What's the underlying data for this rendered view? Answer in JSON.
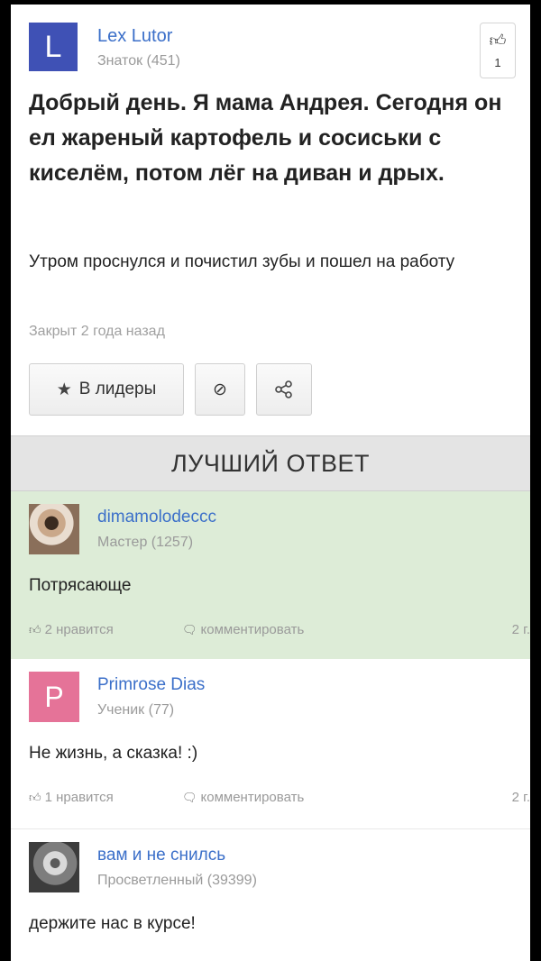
{
  "question": {
    "avatar_letter": "L",
    "user_name": "Lex Lutor",
    "user_rank": "Знаток (451)",
    "like_icon": "thumbs-up-icon",
    "like_count": "1",
    "title": "Добрый день. Я мама Андрея. Сегодня он ел жареный картофель и сосиськи с киселём, потом лёг на диван и дрых.",
    "body": "Утром проснулся и почистил зубы и пошел на работу",
    "closed": "Закрыт 2 года назад",
    "buttons": {
      "leaders_icon": "★",
      "leaders": "В лидеры",
      "block_icon": "⊘",
      "share_icon": "share-icon"
    },
    "colors": {
      "avatar": "#3f51b5",
      "link": "#3b6fc9"
    }
  },
  "best_answer_label": "ЛУЧШИЙ ОТВЕТ",
  "answers": [
    {
      "user_name": "dimamolodeccc",
      "user_rank": "Мастер (1257)",
      "avatar": "cat-photo",
      "text": "Потрясающе",
      "likes": "2 нравится",
      "comment": "комментировать",
      "time": "2 г.",
      "background": "#ddecd7"
    },
    {
      "avatar_letter": "P",
      "user_name": "Primrose Dias",
      "user_rank": "Ученик (77)",
      "text": "Не жизнь, а сказка! :)",
      "likes": "1 нравится",
      "comment": "комментировать",
      "time": "2 г."
    },
    {
      "user_name": "вам и не снилсь",
      "user_rank": "Просветленный (39399)",
      "avatar": "old-man-photo",
      "text": "держите нас в курсе!"
    }
  ]
}
